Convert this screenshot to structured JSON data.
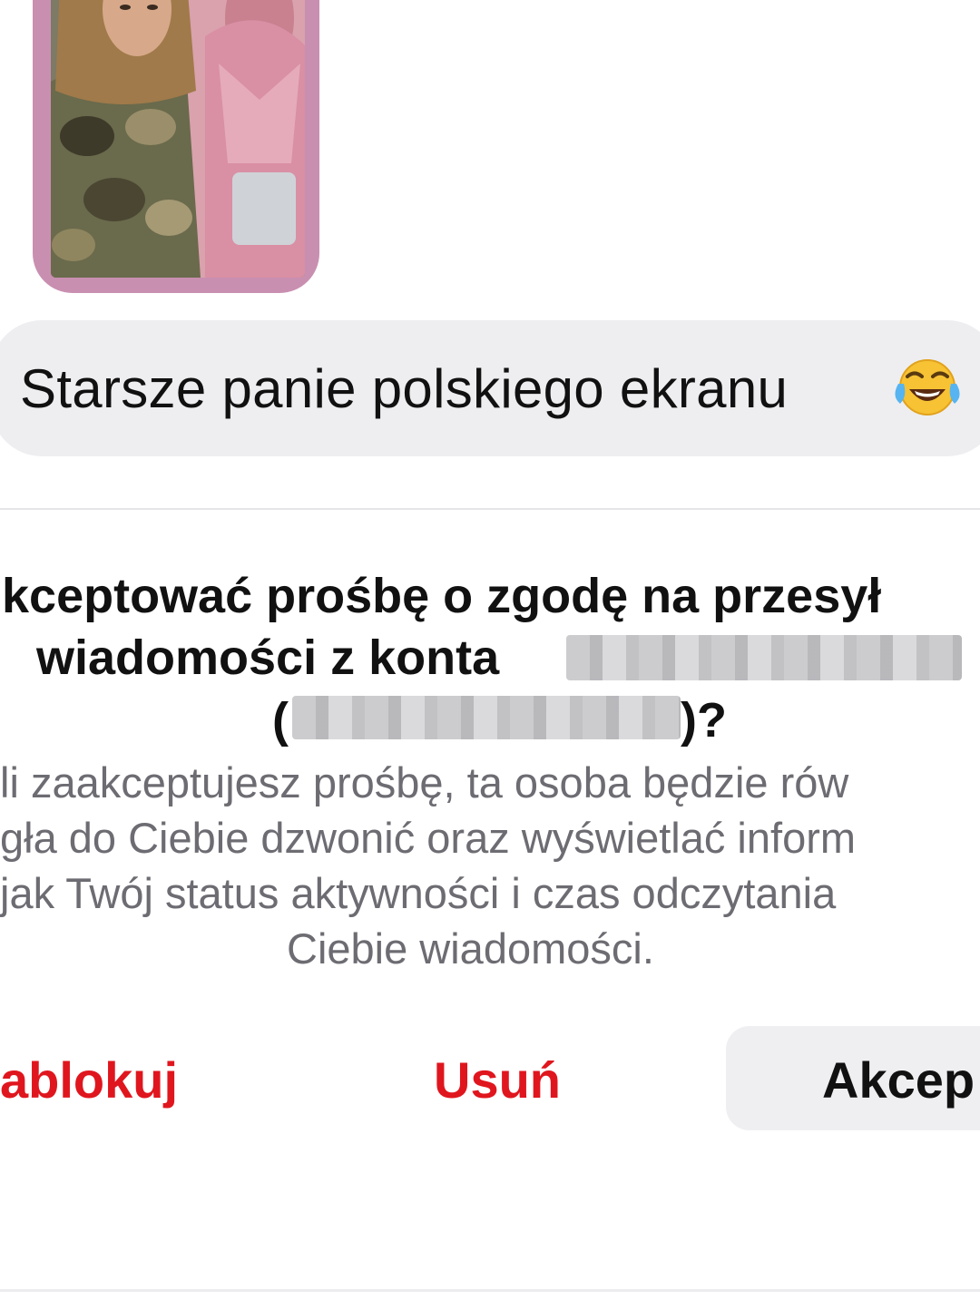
{
  "message": {
    "text": "Starsze panie polskiego ekranu",
    "emoji": "face-with-tears-of-joy-icon"
  },
  "request": {
    "title_line1": "kceptować prośbę o zgodę na przesył",
    "title_line2": "wiadomości z konta ",
    "title_line3_open": "(",
    "title_line3_close": ")?",
    "body_line1": "li zaakceptujesz prośbę, ta osoba będzie rów",
    "body_line2": "gła do Ciebie dzwonić oraz wyświetlać inform",
    "body_line3": "jak Twój status aktywności i czas odczytania",
    "body_line4": "Ciebie wiadomości."
  },
  "actions": {
    "block_label": "ablokuj",
    "delete_label": "Usuń",
    "accept_label": "Akcep"
  },
  "colors": {
    "destructive": "#e0161e",
    "bubble": "#eeeef1",
    "muted_text": "#6c6c72",
    "story_border": "#c98fb0"
  }
}
